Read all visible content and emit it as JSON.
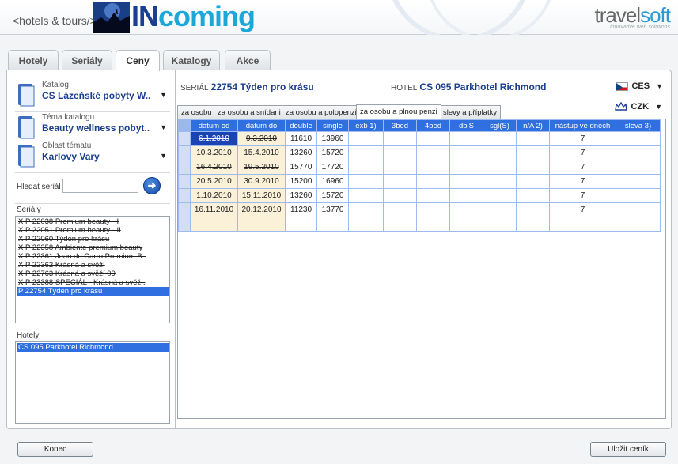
{
  "brand": {
    "left_text": "<hotels & tours/>",
    "main_part1": "IN",
    "main_part2": "coming",
    "right_part1": "travel",
    "right_part2": "soft",
    "right_tagline": "innovative web solutions"
  },
  "main_tabs": [
    {
      "label": "Hotely",
      "active": false
    },
    {
      "label": "Seriály",
      "active": false
    },
    {
      "label": "Ceny",
      "active": true
    },
    {
      "label": "Katalogy",
      "active": false
    },
    {
      "label": "Akce",
      "active": false
    }
  ],
  "filters": {
    "catalog": {
      "label": "Katalog",
      "value": "CS Lázeňské pobyty W.."
    },
    "theme": {
      "label": "Téma katalogu",
      "value": "Beauty  wellness pobyt.."
    },
    "area": {
      "label": "Oblast tématu",
      "value": "Karlovy Vary"
    }
  },
  "search": {
    "label": "Hledat seriál",
    "value": ""
  },
  "serials_list": {
    "label": "Seriály",
    "items": [
      {
        "text": "X P 22038 Premium beauty - I",
        "struck": true,
        "selected": false
      },
      {
        "text": "X P 22051 Premium beauty - II",
        "struck": true,
        "selected": false
      },
      {
        "text": "X P 22060 Týden pro krásu",
        "struck": true,
        "selected": false
      },
      {
        "text": "X P 22358 Ambiente premium beauty",
        "struck": true,
        "selected": false
      },
      {
        "text": "X P 22361 Jean de Carro Premium B..",
        "struck": true,
        "selected": false
      },
      {
        "text": "X P 22362 Krásná a svěží",
        "struck": true,
        "selected": false
      },
      {
        "text": "X P 22763 Krásná a svěží 09",
        "struck": true,
        "selected": false
      },
      {
        "text": "X P 23388 SPECIÁL - Krásná a svěž..",
        "struck": true,
        "selected": false
      },
      {
        "text": "P 22754 Týden pro krásu",
        "struck": false,
        "selected": true
      }
    ]
  },
  "hotels_list": {
    "label": "Hotely",
    "items": [
      {
        "text": "CS 095 Parkhotel Richmond",
        "selected": true
      }
    ]
  },
  "serial_info": {
    "label": "SERIÁL",
    "value": "22754 Týden pro krásu"
  },
  "hotel_info": {
    "label": "HOTEL",
    "value": "CS 095 Parkhotel Richmond"
  },
  "language": {
    "value": "CES"
  },
  "currency": {
    "value": "CZK"
  },
  "sub_tabs": [
    {
      "label": "za osobu",
      "active": false
    },
    {
      "label": "za osobu a snídani",
      "active": false
    },
    {
      "label": "za osobu a polopenzi",
      "active": false
    },
    {
      "label": "za osobu a plnou penzi",
      "active": true
    },
    {
      "label": "slevy a příplatky",
      "active": false
    }
  ],
  "grid": {
    "columns": [
      "datum od",
      "datum do",
      "double",
      "single",
      "exb 1)",
      "3bed",
      "4bed",
      "dblS",
      "sgl(S)",
      "n/A 2)",
      "nástup ve dnech",
      "sleva 3)"
    ],
    "rows": [
      {
        "cells": [
          "6.1.2010",
          "9.3.2010",
          "11610",
          "13960",
          "",
          "",
          "",
          "",
          "",
          "",
          "7",
          ""
        ],
        "struck": true,
        "selected_first": true
      },
      {
        "cells": [
          "10.3.2010",
          "15.4.2010",
          "13260",
          "15720",
          "",
          "",
          "",
          "",
          "",
          "",
          "7",
          ""
        ],
        "struck": true,
        "selected_first": false
      },
      {
        "cells": [
          "16.4.2010",
          "19.5.2010",
          "15770",
          "17720",
          "",
          "",
          "",
          "",
          "",
          "",
          "7",
          ""
        ],
        "struck": true,
        "selected_first": false
      },
      {
        "cells": [
          "20.5.2010",
          "30.9.2010",
          "15200",
          "16960",
          "",
          "",
          "",
          "",
          "",
          "",
          "7",
          ""
        ],
        "struck": false,
        "selected_first": false
      },
      {
        "cells": [
          "1.10.2010",
          "15.11.2010",
          "13260",
          "15720",
          "",
          "",
          "",
          "",
          "",
          "",
          "7",
          ""
        ],
        "struck": false,
        "selected_first": false
      },
      {
        "cells": [
          "16.11.2010",
          "20.12.2010",
          "11230",
          "13770",
          "",
          "",
          "",
          "",
          "",
          "",
          "7",
          ""
        ],
        "struck": false,
        "selected_first": false
      },
      {
        "cells": [
          "",
          "",
          "",
          "",
          "",
          "",
          "",
          "",
          "",
          "",
          "",
          ""
        ],
        "struck": false,
        "selected_first": false
      }
    ]
  },
  "buttons": {
    "close": "Konec",
    "save": "Uložit ceník"
  },
  "colors": {
    "accent": "#2f6fe0",
    "brand_dark": "#1a3f8f",
    "brand_light": "#1ca7d9"
  }
}
